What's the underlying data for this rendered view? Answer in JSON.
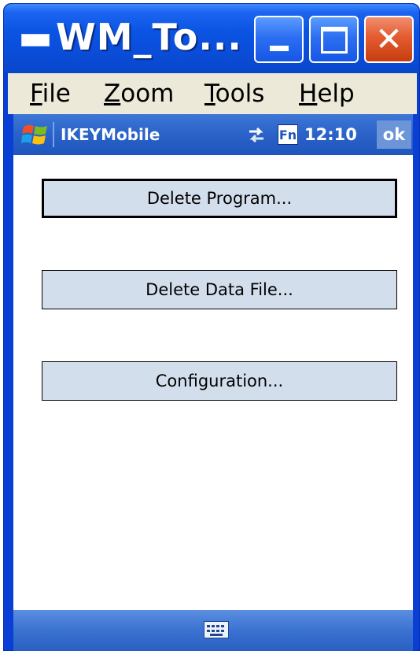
{
  "window": {
    "title": "WM_To...",
    "controls": {
      "minimize_icon": "minimize-icon",
      "maximize_icon": "maximize-icon",
      "close_icon": "close-icon",
      "close_glyph": "✕"
    }
  },
  "menubar": {
    "items": [
      {
        "accel": "F",
        "rest": "ile"
      },
      {
        "accel": "Z",
        "rest": "oom"
      },
      {
        "accel": "T",
        "rest": "ools"
      },
      {
        "accel": "H",
        "rest": "elp"
      }
    ]
  },
  "device": {
    "topbar": {
      "app_title": "IKEYMobile",
      "fn_label": "Fn",
      "time": "12:10",
      "ok_label": "ok"
    },
    "buttons": [
      {
        "label": "Delete Program..."
      },
      {
        "label": "Delete Data File..."
      },
      {
        "label": "Configuration..."
      }
    ],
    "bottombar": {
      "keyboard_icon": "keyboard-icon"
    }
  },
  "colors": {
    "titlebar_blue": "#0a4cd7",
    "menubar_bg": "#ece9d8",
    "topbar_blue": "#2a62c8",
    "button_fill": "#d3deed",
    "close_red": "#e35b2e"
  }
}
